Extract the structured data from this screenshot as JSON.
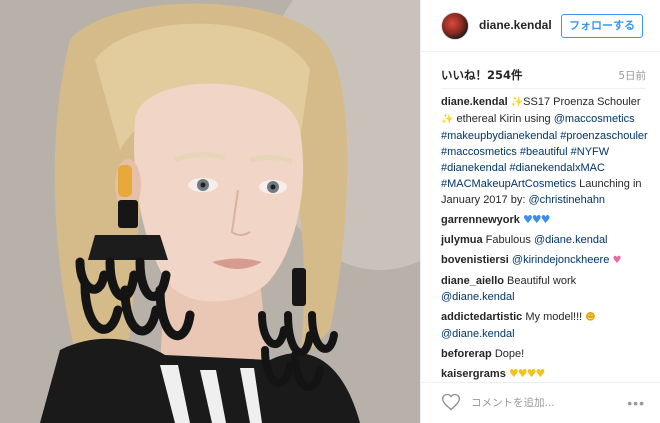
{
  "header": {
    "username": "diane.kendal",
    "follow_label": "フォローする"
  },
  "meta": {
    "likes": "いいね！254件",
    "age": "5日前"
  },
  "caption": {
    "user": "diane.kendal",
    "parts": [
      {
        "text": "✨",
        "kind": "emoji-sparkle"
      },
      {
        "text": "SS17 Proenza Schouler ",
        "kind": "text"
      },
      {
        "text": "✨",
        "kind": "emoji-sparkle"
      },
      {
        "text": " ethereal Kirin using ",
        "kind": "text"
      },
      {
        "text": "@maccosmetics",
        "kind": "tag"
      },
      {
        "text": " ",
        "kind": "text"
      },
      {
        "text": "#makeupbydianekendal",
        "kind": "tag"
      },
      {
        "text": " ",
        "kind": "text"
      },
      {
        "text": "#proenzaschouler",
        "kind": "tag"
      },
      {
        "text": " ",
        "kind": "text"
      },
      {
        "text": "#maccosmetics",
        "kind": "tag"
      },
      {
        "text": " ",
        "kind": "text"
      },
      {
        "text": "#beautiful",
        "kind": "tag"
      },
      {
        "text": " ",
        "kind": "text"
      },
      {
        "text": "#NYFW",
        "kind": "tag"
      },
      {
        "text": " ",
        "kind": "text"
      },
      {
        "text": "#dianekendal",
        "kind": "tag"
      },
      {
        "text": " ",
        "kind": "text"
      },
      {
        "text": "#dianekendalxMAC",
        "kind": "tag"
      },
      {
        "text": " ",
        "kind": "text"
      },
      {
        "text": "#MACMakeupArtCosmetics",
        "kind": "tag"
      },
      {
        "text": " Launching in January 2017 by: ",
        "kind": "text"
      },
      {
        "text": "@christinehahn",
        "kind": "tag"
      }
    ]
  },
  "comments": [
    {
      "user": "garrennewyork",
      "parts": [
        {
          "text": "♥♥♥",
          "kind": "emoji-blue"
        }
      ]
    },
    {
      "user": "julymua",
      "parts": [
        {
          "text": "Fabulous ",
          "kind": "text"
        },
        {
          "text": "@diane.kendal",
          "kind": "tag"
        }
      ]
    },
    {
      "user": "bovenistiersi",
      "parts": [
        {
          "text": "@kirindejonckheere",
          "kind": "tag"
        },
        {
          "text": " ♥",
          "kind": "emoji-pink"
        }
      ]
    },
    {
      "user": "diane_aiello",
      "parts": [
        {
          "text": "Beautiful work ",
          "kind": "text"
        },
        {
          "text": "@diane.kendal",
          "kind": "tag"
        }
      ]
    },
    {
      "user": "addictedartistic",
      "parts": [
        {
          "text": "My model!!! ",
          "kind": "text"
        },
        {
          "text": "☻",
          "kind": "emoji-wink"
        },
        {
          "text": " ",
          "kind": "text"
        },
        {
          "text": "@diane.kendal",
          "kind": "tag"
        }
      ]
    },
    {
      "user": "beforerap",
      "parts": [
        {
          "text": "Dope!",
          "kind": "text"
        }
      ]
    },
    {
      "user": "kaisergrams",
      "parts": [
        {
          "text": "♥♥♥♥",
          "kind": "emoji-yellow"
        }
      ]
    }
  ],
  "footer": {
    "comment_placeholder": "コメントを追加...",
    "more_label": "•••"
  },
  "icons": {
    "like": "heart-outline-icon",
    "avatar": "profile-avatar"
  },
  "colors": {
    "link": "#003569",
    "follow_blue": "#3897f0",
    "muted": "#999999"
  }
}
